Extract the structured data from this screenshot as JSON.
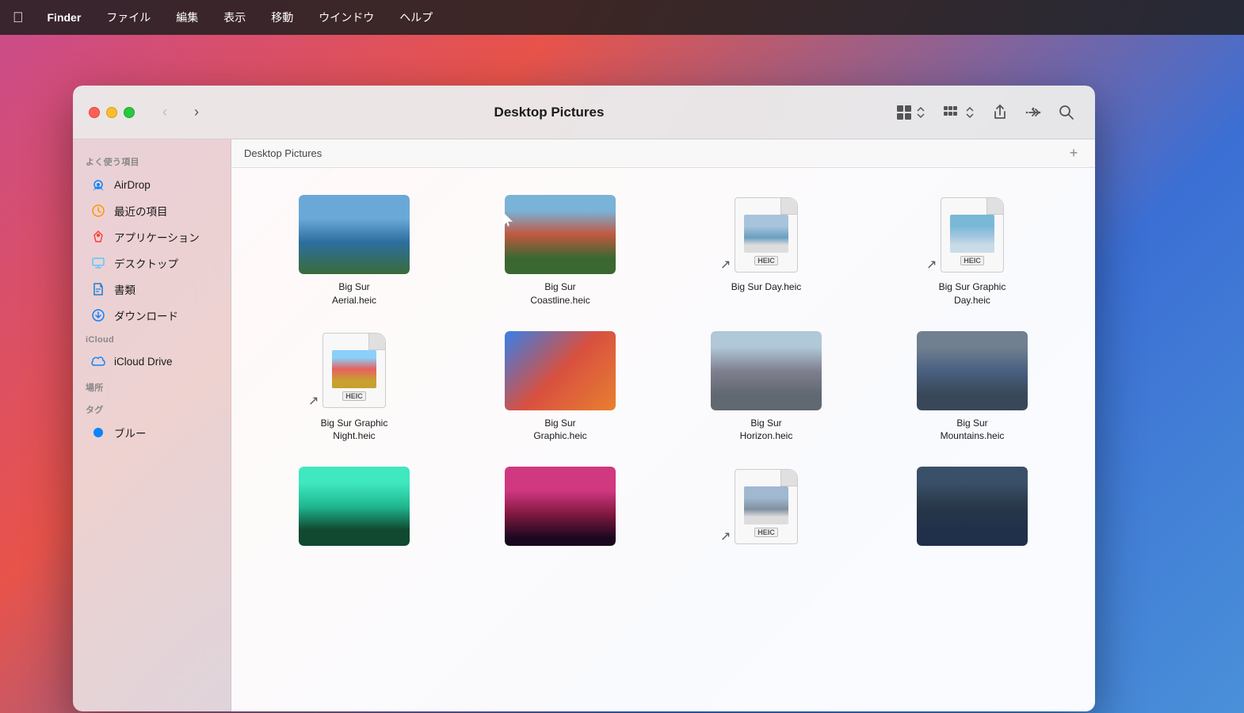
{
  "menubar": {
    "apple": "",
    "items": [
      {
        "label": "Finder"
      },
      {
        "label": "ファイル"
      },
      {
        "label": "編集"
      },
      {
        "label": "表示"
      },
      {
        "label": "移動"
      },
      {
        "label": "ウインドウ"
      },
      {
        "label": "ヘルプ"
      }
    ]
  },
  "toolbar": {
    "title": "Desktop Pictures",
    "view_icon_label": "⊞",
    "more_label": "⋯"
  },
  "sidebar": {
    "favorites_label": "よく使う項目",
    "items": [
      {
        "label": "AirDrop",
        "icon": "airdrop"
      },
      {
        "label": "最近の項目",
        "icon": "recent"
      },
      {
        "label": "アプリケーション",
        "icon": "apps"
      },
      {
        "label": "デスクトップ",
        "icon": "desktop"
      },
      {
        "label": "書類",
        "icon": "docs"
      },
      {
        "label": "ダウンロード",
        "icon": "downloads"
      }
    ],
    "icloud_label": "iCloud",
    "icloud_items": [
      {
        "label": "iCloud Drive",
        "icon": "icloud"
      }
    ],
    "places_label": "場所",
    "tags_label": "タグ",
    "tag_items": [
      {
        "label": "ブルー",
        "color": "#0a84ff"
      }
    ]
  },
  "pathbar": {
    "path": "Desktop Pictures",
    "plus": "+"
  },
  "files": [
    {
      "name": "Big Sur\nAerial.heic",
      "type": "image",
      "thumb_class": "thumb-bigsur-aerial"
    },
    {
      "name": "Big Sur\nCoastline.heic",
      "type": "image",
      "thumb_class": "thumb-bigsur-coastline"
    },
    {
      "name": "Big Sur Day.heic",
      "type": "heic",
      "thumb_class": "thumb-bigsur-day-preview"
    },
    {
      "name": "Big Sur Graphic\nDay.heic",
      "type": "heic",
      "thumb_class": "thumb-bigsur-graphicday-preview"
    },
    {
      "name": "Big Sur Graphic\nNight.heic",
      "type": "heic",
      "thumb_class": "thumb-bigsur-graphicnight"
    },
    {
      "name": "Big Sur\nGraphic.heic",
      "type": "image",
      "thumb_class": "thumb-bigsur-graphic"
    },
    {
      "name": "Big Sur\nHorizon.heic",
      "type": "image",
      "thumb_class": "thumb-bigsur-horizon"
    },
    {
      "name": "Big Sur\nMountains.heic",
      "type": "image",
      "thumb_class": "thumb-bigsur-mountains"
    },
    {
      "name": "",
      "type": "image",
      "thumb_class": "thumb-row3-1"
    },
    {
      "name": "",
      "type": "image",
      "thumb_class": "thumb-row3-2"
    },
    {
      "name": "",
      "type": "heic",
      "thumb_class": "thumb-row3-3-preview"
    },
    {
      "name": "",
      "type": "image",
      "thumb_class": "thumb-row3-4"
    }
  ]
}
